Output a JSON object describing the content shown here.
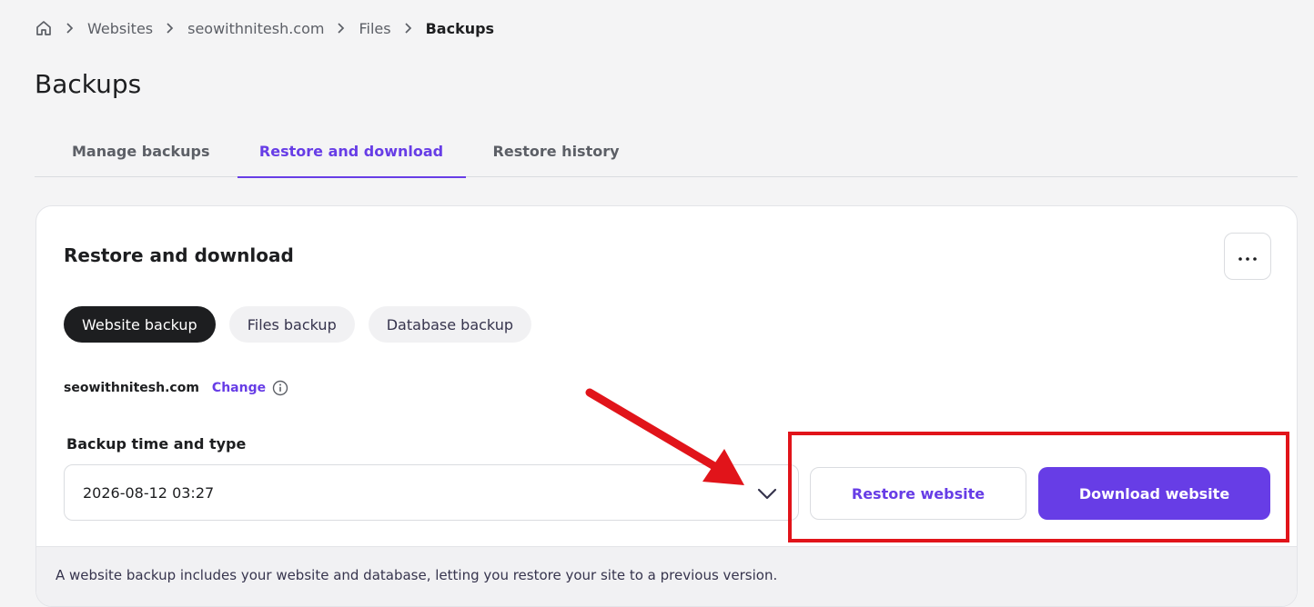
{
  "breadcrumb": {
    "items": [
      "Websites",
      "seowithnitesh.com",
      "Files"
    ],
    "current": "Backups"
  },
  "page_title": "Backups",
  "tabs": [
    {
      "label": "Manage backups",
      "active": false
    },
    {
      "label": "Restore and download",
      "active": true
    },
    {
      "label": "Restore history",
      "active": false
    }
  ],
  "card": {
    "title": "Restore and download",
    "pills": [
      {
        "label": "Website backup",
        "active": true
      },
      {
        "label": "Files backup",
        "active": false
      },
      {
        "label": "Database backup",
        "active": false
      }
    ],
    "domain": "seowithnitesh.com",
    "change_label": "Change",
    "field_label": "Backup time and type",
    "selected_backup": "2026-08-12 03:27",
    "restore_button": "Restore website",
    "download_button": "Download website",
    "note": "A website backup includes your website and database, letting you restore your site to a previous version."
  },
  "colors": {
    "accent": "#673de6",
    "annotation_red": "#e1141a",
    "active_pill": "#1d1e20"
  },
  "icons": [
    "home-icon",
    "chevron-right-icon",
    "more-horizontal-icon",
    "info-icon",
    "chevron-down-icon"
  ]
}
